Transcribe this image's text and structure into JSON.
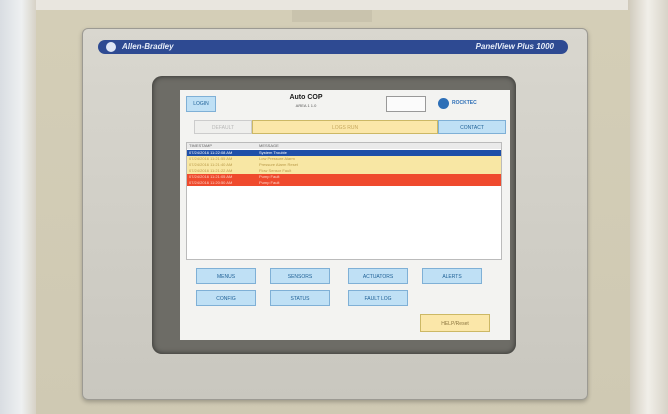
{
  "panel": {
    "brand_left": "Allen-Bradley",
    "brand_right": "PanelView Plus 1000"
  },
  "screen": {
    "header": {
      "left_button": "LOGIN",
      "title": "Auto COP",
      "subtitle": "AREA 1 1.0",
      "info_lines": [
        "",
        ""
      ],
      "logo_text": "ROCKTEC"
    },
    "tabs": {
      "left": "DEFAULT",
      "middle": "LOGS RUN",
      "right": "CONTACT"
    },
    "alarm_table": {
      "columns": [
        "TIMESTAMP",
        "MESSAGE"
      ],
      "rows": [
        {
          "time": "07/24/2016 11:22:08 AM",
          "message": "System Trouble"
        },
        {
          "time": "07/24/2016 11:21:55 AM",
          "message": "Low Pressure Alarm"
        },
        {
          "time": "07/24/2016 11:21:40 AM",
          "message": "Pressure Alarm Reset"
        },
        {
          "time": "07/24/2016 11:21:22 AM",
          "message": "Flow Sensor Fault"
        },
        {
          "time": "07/24/2016 11:21:05 AM",
          "message": "Pump Fault"
        },
        {
          "time": "07/24/2016 11:20:50 AM",
          "message": "Pump Fault"
        }
      ]
    },
    "buttons": {
      "menus": "MENUS",
      "sensors": "SENSORS",
      "actuators": "ACTUATORS",
      "alerts": "ALERTS",
      "config": "CONFIG",
      "status": "STATUS",
      "fault_log": "FAULT LOG",
      "help": "HELP/Reset"
    }
  }
}
